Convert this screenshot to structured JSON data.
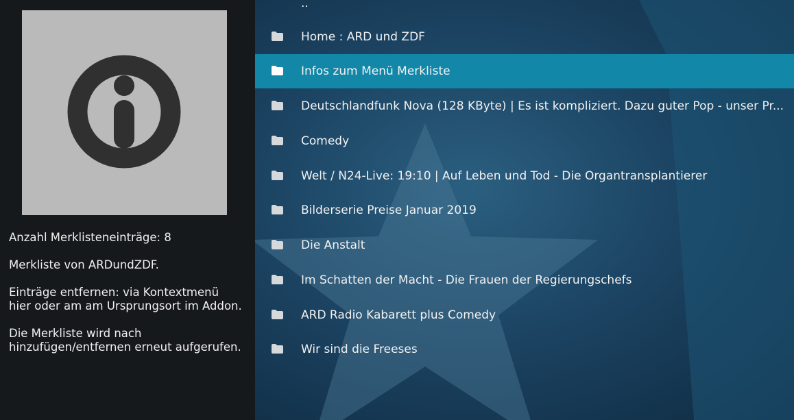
{
  "thumbnail": {
    "icon": "info-circle-icon",
    "bg_color": "#bababa",
    "fg_color": "#303030"
  },
  "info": {
    "count_text": "Anzahl Merklisteneinträge: 8",
    "owner_text": "Merkliste von ARDundZDF.",
    "remove_text": "Einträge entfernen: via Kontextmenü hier oder am am Ursprungsort im Addon.",
    "reload_text": "Die Merkliste wird nach hinzufügen/entfernen erneut aufgerufen."
  },
  "list": {
    "parent_label": "..",
    "items": [
      {
        "label": "Home : ARD und ZDF",
        "icon": "folder-icon"
      },
      {
        "label": "Infos zum Menü Merkliste",
        "icon": "folder-icon",
        "selected": true
      },
      {
        "label": "Deutschlandfunk Nova (128 KByte) | Es ist kompliziert. Dazu guter Pop - unser Pr...",
        "icon": "folder-icon"
      },
      {
        "label": "Comedy",
        "icon": "folder-icon"
      },
      {
        "label": "Welt / N24-Live:  19:10 | Auf Leben und Tod - Die Organtransplantierer",
        "icon": "folder-icon"
      },
      {
        "label": "Bilderserie Preise Januar 2019",
        "icon": "folder-icon"
      },
      {
        "label": "Die Anstalt",
        "icon": "folder-icon"
      },
      {
        "label": "Im Schatten der Macht - Die Frauen der Regierungschefs",
        "icon": "folder-icon"
      },
      {
        "label": "ARD Radio Kabarett plus Comedy",
        "icon": "folder-icon"
      },
      {
        "label": "Wir sind die Freeses",
        "icon": "folder-icon"
      }
    ]
  },
  "colors": {
    "selection": "#1287a8",
    "panel_bg": "#16191c",
    "text": "#f2f2f2"
  }
}
